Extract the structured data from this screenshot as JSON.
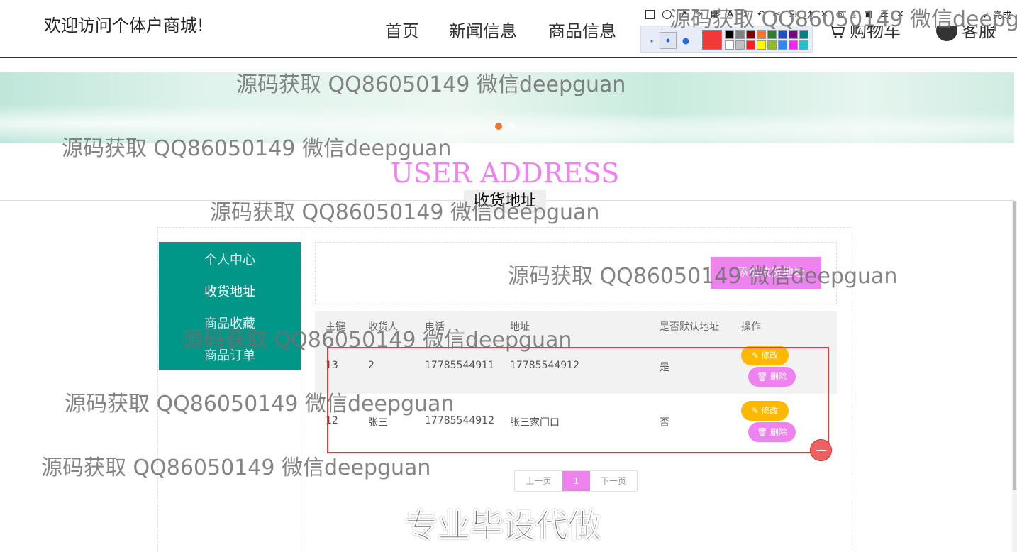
{
  "header": {
    "brand": "欢迎访问个体户商城!",
    "nav": [
      "首页",
      "新闻信息",
      "商品信息"
    ],
    "cart": "购物车",
    "service": "客服"
  },
  "toolbar": {
    "done": "完成",
    "current_color": "#f03a3a",
    "swatches": [
      "#000000",
      "#808080",
      "#800000",
      "#f07830",
      "#2e7d32",
      "#1e4fbf",
      "#800080",
      "#008080",
      "#ffffff",
      "#c0c0c0",
      "#ff2020",
      "#ffff00",
      "#90c020",
      "#2b8ce8",
      "#ff20ff",
      "#20c0d0"
    ]
  },
  "banner": {
    "active_dot_color": "#f0772e"
  },
  "page": {
    "title_en": "USER ADDRESS",
    "title_cn": "收货地址"
  },
  "sidebar": {
    "items": [
      {
        "label": "个人中心"
      },
      {
        "label": "收货地址"
      },
      {
        "label": "商品收藏"
      },
      {
        "label": "商品订单"
      }
    ]
  },
  "actions": {
    "add_label": "+ 添加收货地址"
  },
  "table": {
    "columns": [
      "主键",
      "收货人",
      "电话",
      "地址",
      "是否默认地址",
      "操作"
    ],
    "rows": [
      {
        "id": "13",
        "name": "2",
        "phone": "17785544911",
        "address": "17785544912",
        "is_default": "是",
        "edit": "修改",
        "delete": "删除"
      },
      {
        "id": "12",
        "name": "张三",
        "phone": "17785544912",
        "address": "张三家门口",
        "is_default": "否",
        "edit": "修改",
        "delete": "删除"
      }
    ]
  },
  "pagination": {
    "prev": "上一页",
    "current": "1",
    "next": "下一页"
  },
  "promo": "专业毕设代做",
  "watermark": "源码获取 QQ86050149 微信deepguan",
  "colors": {
    "teal": "#009688",
    "pink": "#ee82ee",
    "orange": "#ffb800",
    "highlight": "#e03c3c"
  }
}
